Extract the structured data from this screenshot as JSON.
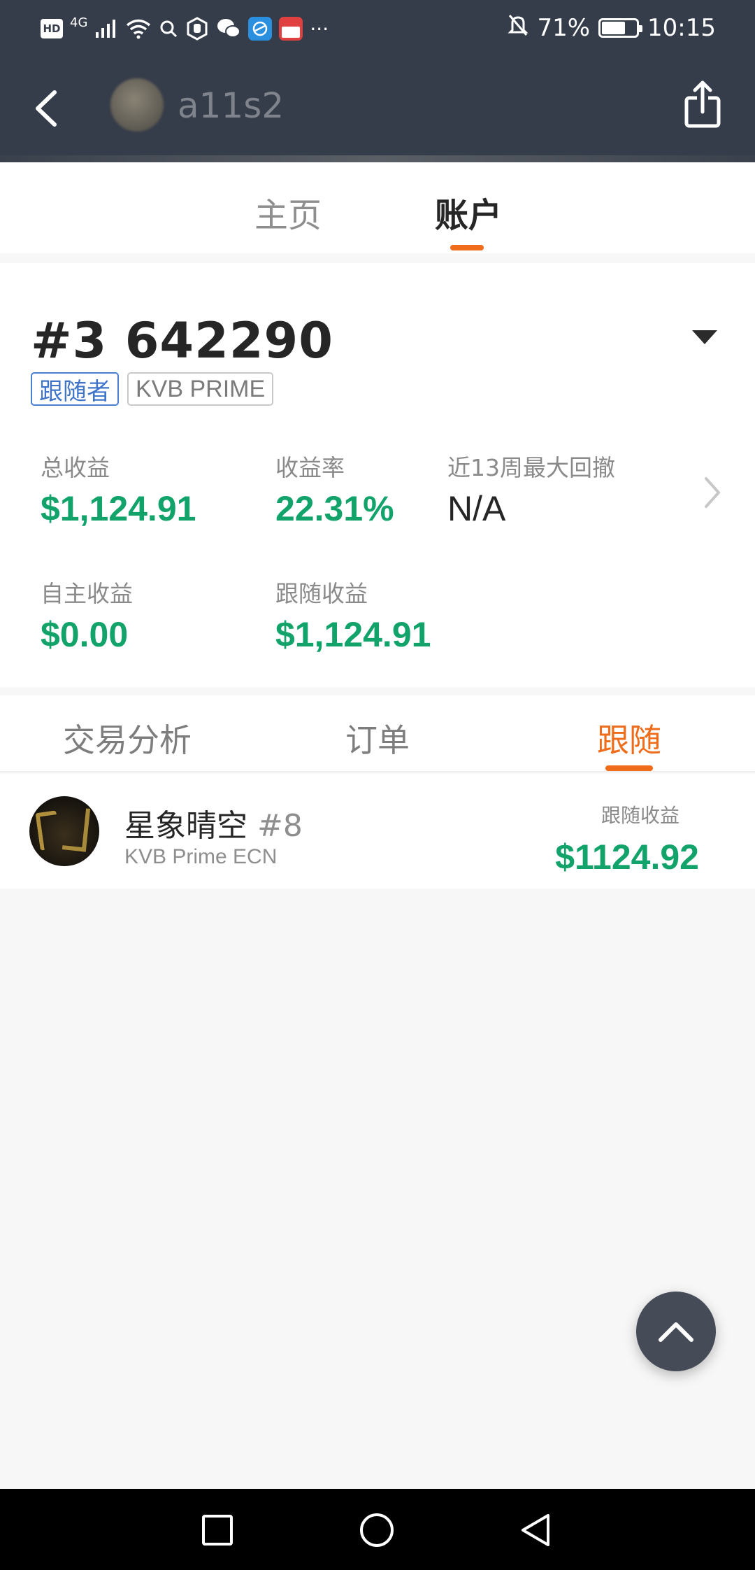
{
  "status_bar": {
    "hd": "HD",
    "network": "4G",
    "more": "···",
    "battery": "71%",
    "time": "10:15",
    "battery_level": 0.71
  },
  "header": {
    "username": "a11s2"
  },
  "main_tabs": [
    {
      "label": "主页",
      "active": false
    },
    {
      "label": "账户",
      "active": true
    }
  ],
  "account": {
    "number": "#3 642290",
    "tags": [
      "跟随者",
      "KVB PRIME"
    ],
    "stats": {
      "total_profit": {
        "label": "总收益",
        "value": "$1,124.91"
      },
      "return_rate": {
        "label": "收益率",
        "value": "22.31%"
      },
      "max_drawdown": {
        "label": "近13周最大回撤",
        "value": "N/A"
      },
      "self_profit": {
        "label": "自主收益",
        "value": "$0.00"
      },
      "follow_profit": {
        "label": "跟随收益",
        "value": "$1,124.91"
      }
    }
  },
  "sub_tabs": [
    {
      "label": "交易分析",
      "active": false
    },
    {
      "label": "订单",
      "active": false
    },
    {
      "label": "跟随",
      "active": true
    }
  ],
  "follow_list": [
    {
      "name": "星象晴空",
      "number": "#8",
      "server": "KVB Prime ECN",
      "profit_label": "跟随收益",
      "profit": "$1124.92"
    }
  ],
  "colors": {
    "header_bg": "#363d4a",
    "accent": "#ef6c1a",
    "profit_green": "#12a36b",
    "tag_blue": "#3f74c9"
  },
  "icons": [
    "back-arrow-icon",
    "share-icon",
    "dropdown-caret-icon",
    "chevron-right-icon",
    "scroll-top-icon",
    "nav-recents-icon",
    "nav-home-icon",
    "nav-back-icon"
  ]
}
